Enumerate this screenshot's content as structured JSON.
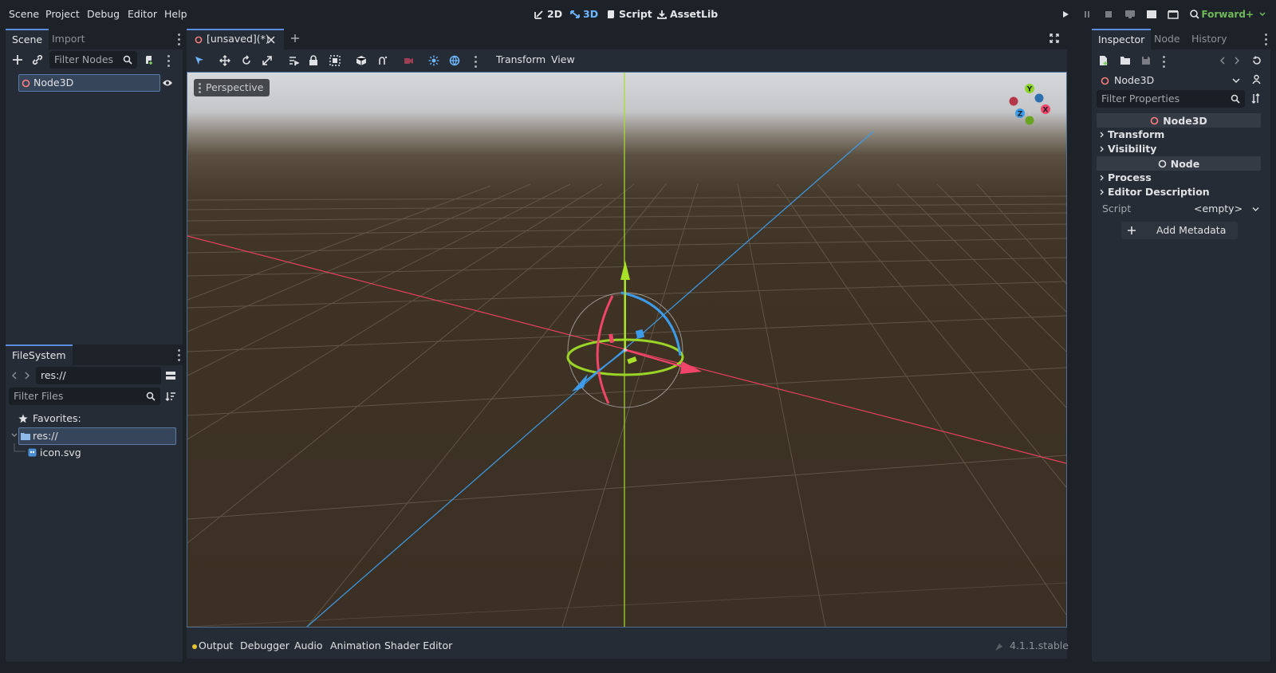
{
  "menubar": {
    "items": [
      "Scene",
      "Project",
      "Debug",
      "Editor",
      "Help"
    ],
    "workspaces": [
      {
        "label": "2D",
        "icon": "2d-icon",
        "active": false
      },
      {
        "label": "3D",
        "icon": "3d-icon",
        "active": true
      },
      {
        "label": "Script",
        "icon": "script-icon",
        "active": false
      },
      {
        "label": "AssetLib",
        "icon": "assetlib-icon",
        "active": false
      }
    ],
    "renderer": "Forward+"
  },
  "scene_dock": {
    "tabs": [
      "Scene",
      "Import"
    ],
    "filter_placeholder": "Filter Nodes",
    "tree": [
      {
        "label": "Node3D",
        "selected": true
      }
    ]
  },
  "filesystem_dock": {
    "tab": "FileSystem",
    "path": "res://",
    "filter_placeholder": "Filter Files",
    "items": {
      "favorites": "Favorites:",
      "root": "res://",
      "file": "icon.svg"
    }
  },
  "editor": {
    "tab_label": "[unsaved](*)",
    "toolbar": {
      "transform": "Transform",
      "view": "View"
    },
    "viewport": {
      "perspective_label": "Perspective",
      "gizmo_axes": {
        "x": "X",
        "y": "Y",
        "z": "Z"
      }
    }
  },
  "bottom_panel": {
    "tabs": [
      "Output",
      "Debugger",
      "Audio",
      "Animation",
      "Shader Editor"
    ],
    "version": "4.1.1.stable"
  },
  "inspector": {
    "tabs": [
      "Inspector",
      "Node",
      "History"
    ],
    "object_name": "Node3D",
    "filter_placeholder": "Filter Properties",
    "sections": {
      "node3d": "Node3D",
      "node": "Node"
    },
    "categories": {
      "transform": "Transform",
      "visibility": "Visibility",
      "process": "Process",
      "editor_description": "Editor Description"
    },
    "script_label": "Script",
    "script_value": "<empty>",
    "add_metadata": "Add Metadata"
  },
  "colors": {
    "accent": "#5c8ddc",
    "x_axis": "#f2456a",
    "y_axis": "#8ed42b",
    "z_axis": "#3d9be9",
    "renderer": "#6fb95a"
  }
}
